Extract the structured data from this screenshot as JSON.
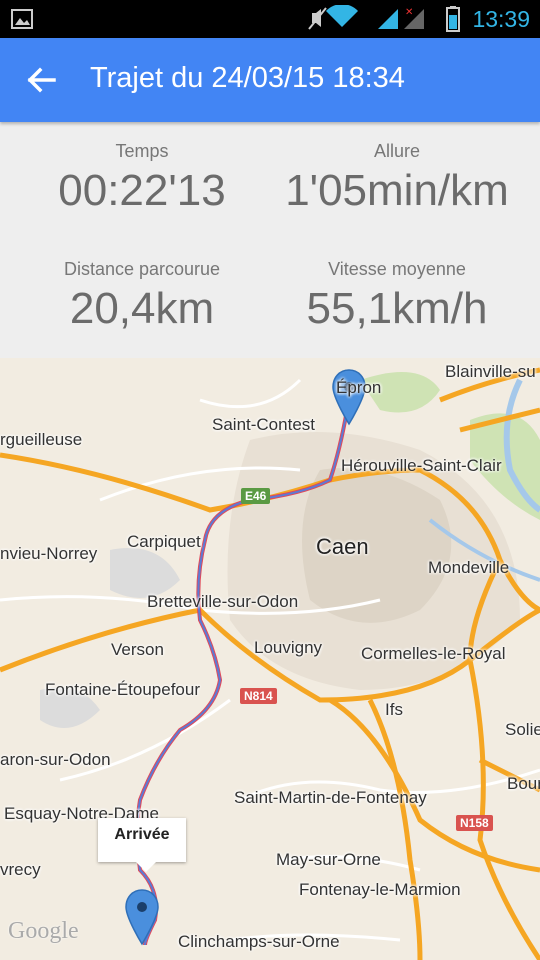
{
  "statusbar": {
    "time": "13:39"
  },
  "appbar": {
    "title": "Trajet du 24/03/15 18:34"
  },
  "stats": {
    "temps_label": "Temps",
    "temps_value": "00:22'13",
    "allure_label": "Allure",
    "allure_value": "1'05min/km",
    "distance_label": "Distance parcourue",
    "distance_value": "20,4km",
    "vitesse_label": "Vitesse moyenne",
    "vitesse_value": "55,1km/h"
  },
  "map": {
    "places": {
      "epron": "Épron",
      "blainville": "Blainville-su",
      "saint_contest": "Saint-Contest",
      "herouville": "Hérouville-Saint-Clair",
      "orgueilleuse": "rgueilleuse",
      "carpiquet": "Carpiquet",
      "caen": "Caen",
      "rots_norrey": "nvieu-Norrey",
      "mondeville": "Mondeville",
      "bretteville": "Bretteville-sur-Odon",
      "verson": "Verson",
      "louvigny": "Louvigny",
      "cormelles": "Cormelles-le-Royal",
      "fontaine": "Fontaine-Étoupefour",
      "ifs": "Ifs",
      "solier": "Solie",
      "baron": "aron-sur-Odon",
      "bourgue": "Bourgu",
      "saint_martin": "Saint-Martin-de-Fontenay",
      "esquay": "Esquay-Notre-Dame",
      "vrecy": "vrecy",
      "may_sur_orne": "May-sur-Orne",
      "fontenay": "Fontenay-le-Marmion",
      "clinchamps": "Clinchamps-sur-Orne"
    },
    "roads": {
      "e46": "E46",
      "n814": "N814",
      "n158": "N158"
    },
    "arrival_label": "Arrivée",
    "attribution": "Google"
  }
}
